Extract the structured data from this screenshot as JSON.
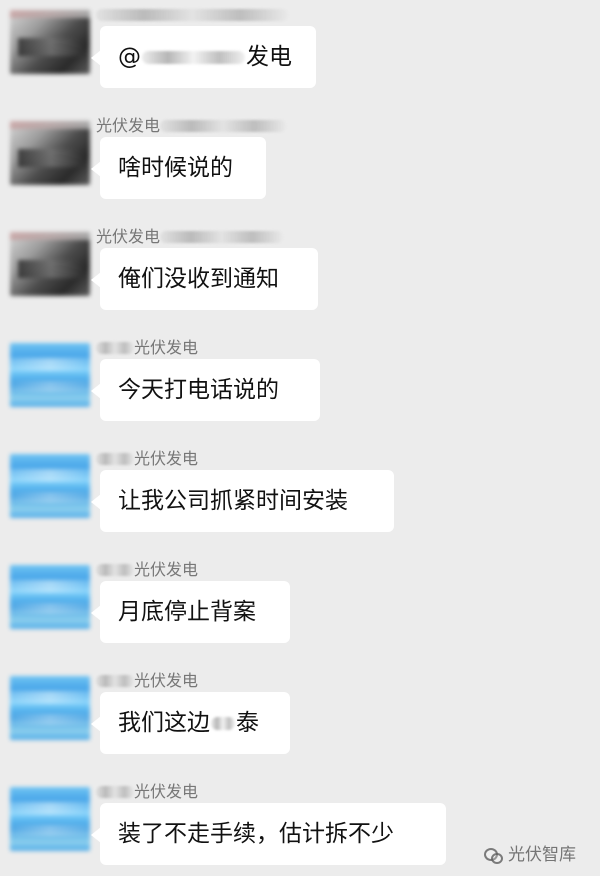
{
  "messages": [
    {
      "sender_prefix": "",
      "sender_suffix": "",
      "text_prefix": "@",
      "text_suffix": "发电"
    },
    {
      "sender_prefix": "光伏发电",
      "sender_suffix": "",
      "text_prefix": "啥时候说的",
      "text_suffix": ""
    },
    {
      "sender_prefix": "光伏发电",
      "sender_suffix": "",
      "text_prefix": "俺们没收到通知",
      "text_suffix": ""
    },
    {
      "sender_prefix": "",
      "sender_suffix": "光伏发电",
      "text_prefix": "今天打电话说的",
      "text_suffix": ""
    },
    {
      "sender_prefix": "",
      "sender_suffix": "光伏发电",
      "text_prefix": "让我公司抓紧时间安装",
      "text_suffix": ""
    },
    {
      "sender_prefix": "",
      "sender_suffix": "光伏发电",
      "text_prefix": "月底停止背案",
      "text_suffix": ""
    },
    {
      "sender_prefix": "",
      "sender_suffix": "光伏发电",
      "text_prefix": "我们这边",
      "text_suffix": "泰"
    },
    {
      "sender_prefix": "",
      "sender_suffix": "光伏发电",
      "text_prefix": "装了不走手续，估计拆不少",
      "text_suffix": ""
    }
  ],
  "watermark": {
    "icon": "wechat-icon",
    "label": "光伏智库"
  },
  "colors": {
    "background": "#ececec",
    "bubble": "#ffffff",
    "text": "#111111",
    "sender": "#777777"
  }
}
